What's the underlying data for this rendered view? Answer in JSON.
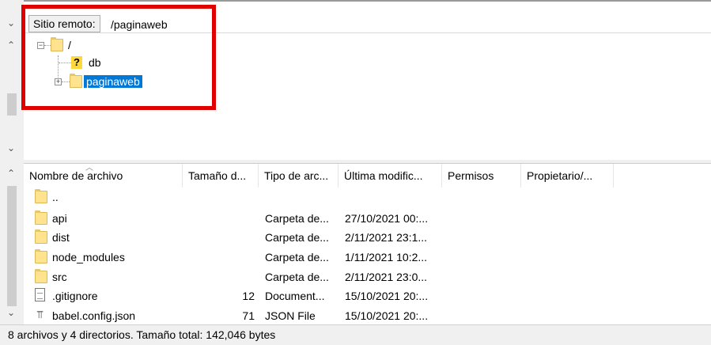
{
  "remote": {
    "label": "Sitio remoto:",
    "path": "/paginaweb"
  },
  "tree": {
    "root": "/",
    "children": [
      {
        "name": "db",
        "icon": "unknown-folder-icon"
      },
      {
        "name": "paginaweb",
        "icon": "folder-icon",
        "selected": true
      }
    ]
  },
  "file_list": {
    "columns": [
      "Nombre de archivo",
      "Tamaño d...",
      "Tipo de arc...",
      "Última modific...",
      "Permisos",
      "Propietario/..."
    ],
    "rows": [
      {
        "name": "..",
        "size": "",
        "type": "",
        "modified": "",
        "icon": "folder-icon"
      },
      {
        "name": "api",
        "size": "",
        "type": "Carpeta de...",
        "modified": "27/10/2021 00:...",
        "icon": "folder-icon"
      },
      {
        "name": "dist",
        "size": "",
        "type": "Carpeta de...",
        "modified": "2/11/2021 23:1...",
        "icon": "folder-icon"
      },
      {
        "name": "node_modules",
        "size": "",
        "type": "Carpeta de...",
        "modified": "1/11/2021 10:2...",
        "icon": "folder-icon"
      },
      {
        "name": "src",
        "size": "",
        "type": "Carpeta de...",
        "modified": "2/11/2021 23:0...",
        "icon": "folder-icon"
      },
      {
        "name": ".gitignore",
        "size": "12",
        "type": "Document...",
        "modified": "15/10/2021 20:...",
        "icon": "document-icon"
      },
      {
        "name": "babel.config.json",
        "size": "71",
        "type": "JSON File",
        "modified": "15/10/2021 20:...",
        "icon": "json-file-icon"
      }
    ]
  },
  "status": {
    "text": "8 archivos y 4 directorios. Tamaño total: 142,046 bytes"
  },
  "colors": {
    "highlight": "#e00000",
    "selection": "#0078d7",
    "folder": "#ffe38e"
  }
}
